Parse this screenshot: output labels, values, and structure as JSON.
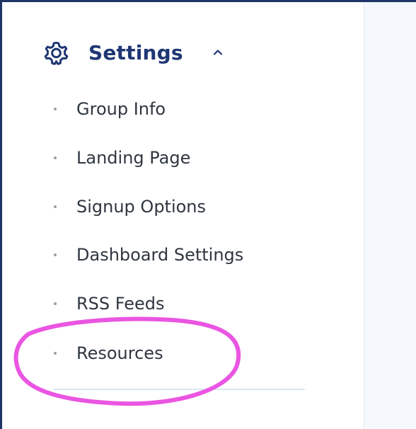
{
  "sidebar": {
    "section": {
      "title": "Settings",
      "icon": "gear-icon",
      "toggle_icon": "chevron-up-icon",
      "expanded": true
    },
    "items": [
      {
        "label": "Group Info"
      },
      {
        "label": "Landing Page"
      },
      {
        "label": "Signup Options"
      },
      {
        "label": "Dashboard Settings"
      },
      {
        "label": "RSS Feeds"
      },
      {
        "label": "Resources"
      }
    ]
  },
  "colors": {
    "accent": "#1f3773",
    "frame": "#1e3566",
    "highlight": "#ea55e2",
    "text": "#2f3640",
    "bullet": "#9aa0a8",
    "main_background": "#f5f8fc"
  },
  "annotation": {
    "type": "ellipse-highlight",
    "target": "Resources"
  }
}
